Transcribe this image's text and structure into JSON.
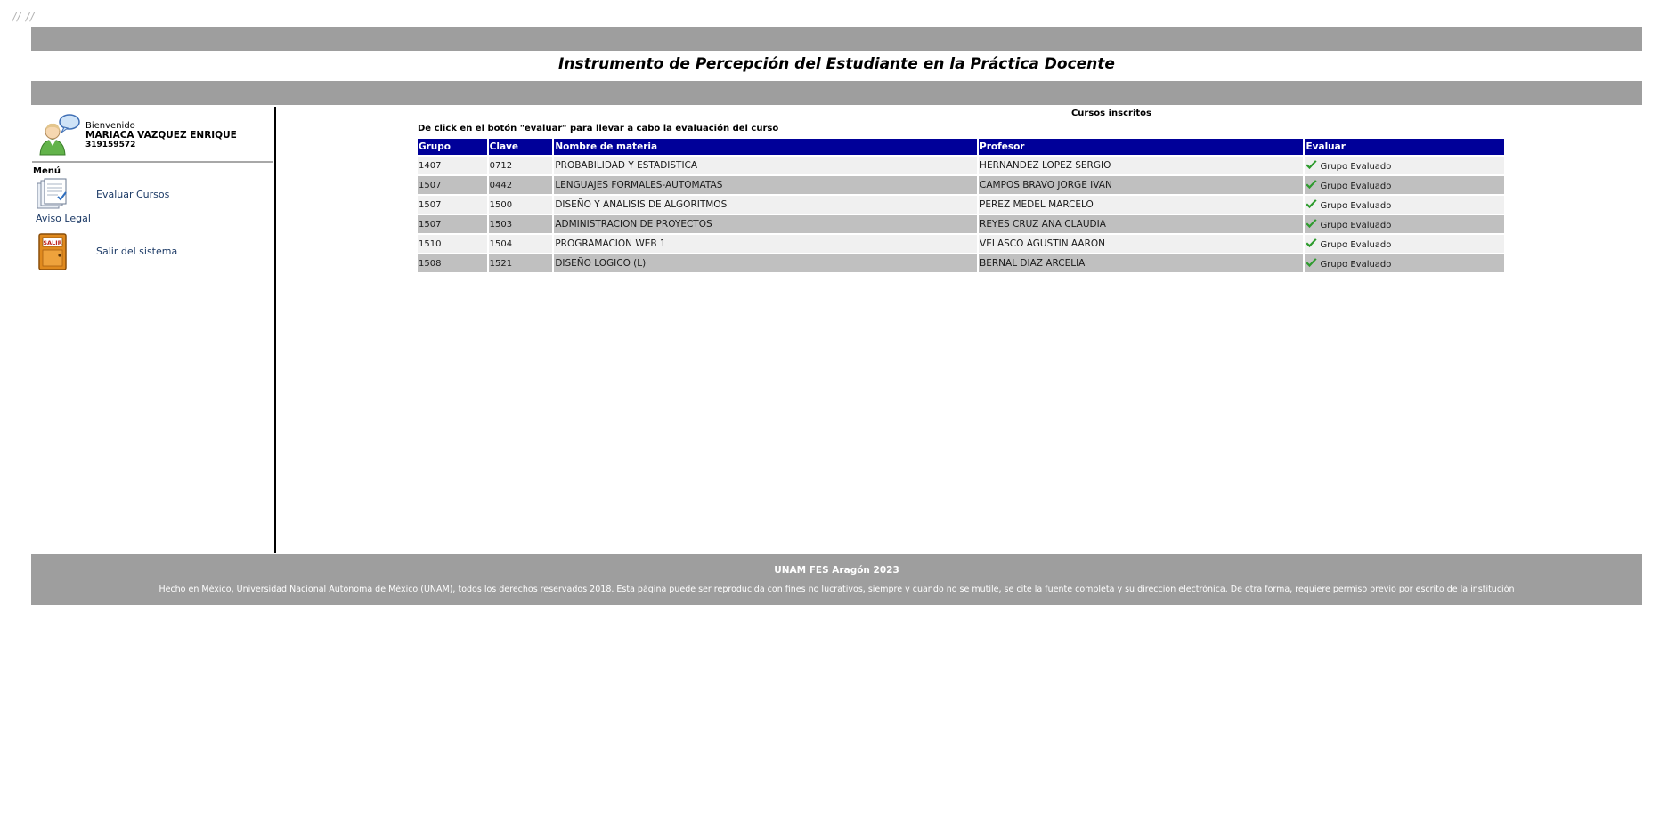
{
  "decor": {
    "corner_marks": "// //"
  },
  "header": {
    "title": "Instrumento de Percepción del Estudiante en la Práctica Docente"
  },
  "sidebar": {
    "greeting": "Bienvenido",
    "user_name": "MARIACA VAZQUEZ ENRIQUE",
    "account_number": "319159572",
    "menu_heading": "Menú",
    "items": [
      {
        "label": "Evaluar Cursos",
        "icon": "documents-checklist-icon"
      },
      {
        "label": "Aviso Legal"
      },
      {
        "label": "Salir del sistema",
        "icon": "exit-door-icon",
        "icon_text": "SALIR"
      }
    ]
  },
  "main": {
    "title": "Cursos inscritos",
    "instruction": "De click en el botón \"evaluar\" para llevar a cabo la evaluación del curso",
    "table": {
      "headers": [
        "Grupo",
        "Clave",
        "Nombre de materia",
        "Profesor",
        "Evaluar"
      ],
      "rows": [
        {
          "grupo": "1407",
          "clave": "0712",
          "materia": "PROBABILIDAD Y ESTADISTICA",
          "profesor": "HERNANDEZ LOPEZ SERGIO",
          "status": "Grupo Evaluado"
        },
        {
          "grupo": "1507",
          "clave": "0442",
          "materia": "LENGUAJES FORMALES-AUTOMATAS",
          "profesor": "CAMPOS BRAVO JORGE IVAN",
          "status": "Grupo Evaluado"
        },
        {
          "grupo": "1507",
          "clave": "1500",
          "materia": "DISEÑO Y ANALISIS DE ALGORITMOS",
          "profesor": "PEREZ MEDEL MARCELO",
          "status": "Grupo Evaluado"
        },
        {
          "grupo": "1507",
          "clave": "1503",
          "materia": "ADMINISTRACION DE PROYECTOS",
          "profesor": "REYES CRUZ ANA CLAUDIA",
          "status": "Grupo Evaluado"
        },
        {
          "grupo": "1510",
          "clave": "1504",
          "materia": "PROGRAMACION WEB 1",
          "profesor": "VELASCO AGUSTIN AARON",
          "status": "Grupo Evaluado"
        },
        {
          "grupo": "1508",
          "clave": "1521",
          "materia": "DISEÑO LOGICO (L)",
          "profesor": "BERNAL DIAZ ARCELIA",
          "status": "Grupo Evaluado"
        }
      ]
    }
  },
  "footer": {
    "line1": "UNAM FES Aragón 2023",
    "line2": "Hecho en México, Universidad Nacional Autónoma de México (UNAM), todos los derechos reservados 2018. Esta página puede ser reproducida con fines no lucrativos, siempre y cuando no se mutile, se cite la fuente completa y su dirección electrónica. De otra forma, requiere permiso previo por escrito de la institución"
  },
  "colors": {
    "bar_gray": "#9e9e9e",
    "table_header_blue": "#000099",
    "row_light": "#f0f0f0",
    "row_dark": "#c0c0c0",
    "link_color": "#1c3a66",
    "check_green": "#2e9b2e"
  }
}
